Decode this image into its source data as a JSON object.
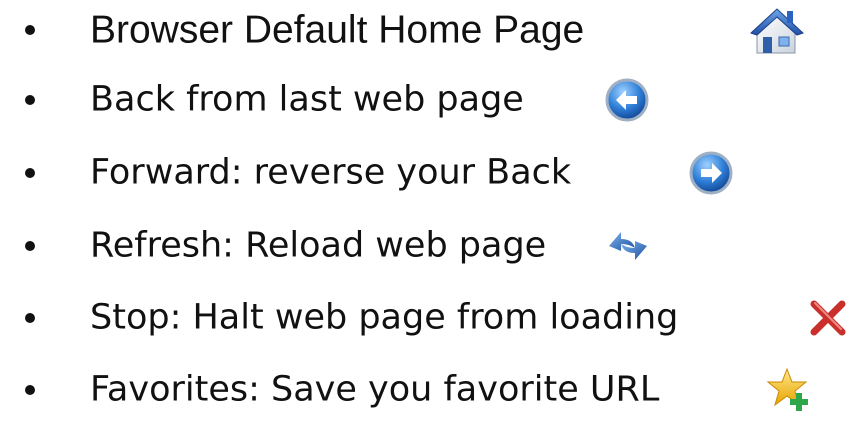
{
  "items": [
    {
      "label": "Browser Default Home Page",
      "icon": "home-icon"
    },
    {
      "label": "Back from last web page",
      "icon": "back-arrow-icon"
    },
    {
      "label": "Forward: reverse your Back",
      "icon": "forward-arrow-icon"
    },
    {
      "label": "Refresh: Reload web page",
      "icon": "refresh-icon"
    },
    {
      "label": "Stop: Halt web page from loading",
      "icon": "stop-icon"
    },
    {
      "label": "Favorites: Save you favorite URL",
      "icon": "add-favorite-icon"
    }
  ]
}
